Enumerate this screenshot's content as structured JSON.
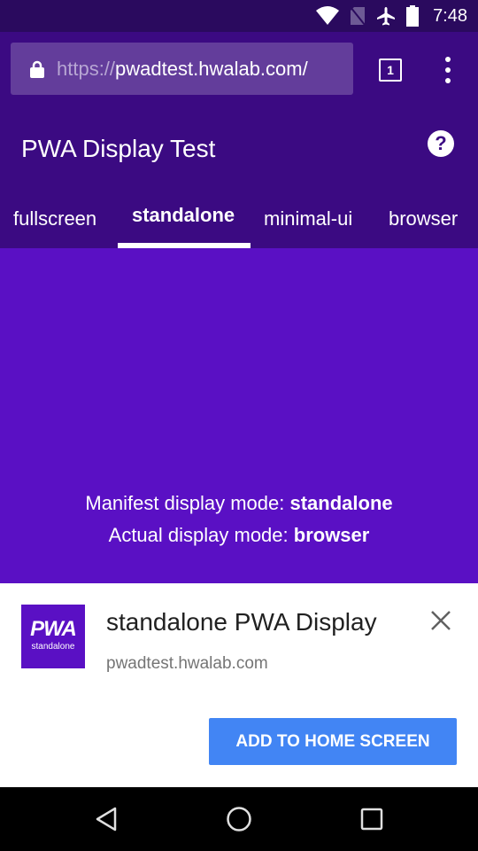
{
  "status_bar": {
    "time": "7:48",
    "icons": [
      "wifi-icon",
      "no-sim-icon",
      "airplane-mode-icon",
      "battery-icon"
    ]
  },
  "browser": {
    "url_scheme": "https://",
    "url_host": "pwadtest.hwalab.com/",
    "tab_count": "1",
    "icons": [
      "lock-icon",
      "tab-switcher-icon",
      "more-menu-icon"
    ]
  },
  "app": {
    "title": "PWA Display Test",
    "help_icon": "?",
    "tabs": [
      {
        "label": "fullscreen",
        "active": false
      },
      {
        "label": "standalone",
        "active": true
      },
      {
        "label": "minimal-ui",
        "active": false
      },
      {
        "label": "browser",
        "active": false
      }
    ]
  },
  "main": {
    "manifest_label": "Manifest display mode: ",
    "manifest_value": "standalone",
    "actual_label": "Actual display mode: ",
    "actual_value": "browser"
  },
  "install_banner": {
    "icon_text": "PWA",
    "icon_subtext": "standalone",
    "title": "standalone PWA Display",
    "url": "pwadtest.hwalab.com",
    "button_label": "ADD TO HOME SCREEN"
  },
  "colors": {
    "status_bar": "#2a0a5e",
    "header": "#3b0a82",
    "main": "#5a10c4",
    "button": "#4285f4"
  }
}
